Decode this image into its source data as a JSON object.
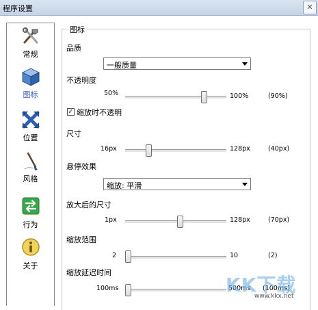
{
  "window": {
    "title": "程序设置",
    "close_glyph": "✕"
  },
  "sidebar": {
    "items": [
      {
        "label": "常规",
        "icon": "tools-icon"
      },
      {
        "label": "图标",
        "icon": "cube-icon",
        "active": true
      },
      {
        "label": "位置",
        "icon": "arrows-cross-icon"
      },
      {
        "label": "风格",
        "icon": "brush-icon"
      },
      {
        "label": "行为",
        "icon": "refresh-arrows-icon"
      },
      {
        "label": "关于",
        "icon": "info-icon"
      }
    ]
  },
  "group": {
    "title": "图标"
  },
  "quality": {
    "label": "品质",
    "value": "一般质量"
  },
  "opacity": {
    "label": "不透明度",
    "min": "50%",
    "max": "100%",
    "value_text": "(90%)",
    "value": 90,
    "range": [
      50,
      100
    ]
  },
  "zoom_opaque": {
    "label": "缩放时不透明",
    "checked": true,
    "check_glyph": "✓"
  },
  "size": {
    "label": "尺寸",
    "min": "16px",
    "max": "128px",
    "value_text": "(40px)",
    "value": 40,
    "range": [
      16,
      128
    ]
  },
  "hover": {
    "label": "悬停效果",
    "value": "缩放: 平滑"
  },
  "zoom_size": {
    "label": "放大后的尺寸",
    "min": "1px",
    "max": "128px",
    "value_text": "(70px)",
    "value": 70,
    "range": [
      1,
      128
    ]
  },
  "zoom_range": {
    "label": "缩放范围",
    "min": "2",
    "max": "10",
    "value_text": "(2)",
    "value": 2,
    "range": [
      2,
      10
    ]
  },
  "zoom_delay": {
    "label": "缩放延迟时间",
    "min": "100ms",
    "max": "500ms",
    "value_text": "(100ms)",
    "value": 100,
    "range": [
      100,
      500
    ]
  },
  "watermark": {
    "logo": "KK下载",
    "url": "www.kkx.net"
  },
  "colors": {
    "accent": "#3760c4",
    "titlebar": "#c4d3e6"
  }
}
